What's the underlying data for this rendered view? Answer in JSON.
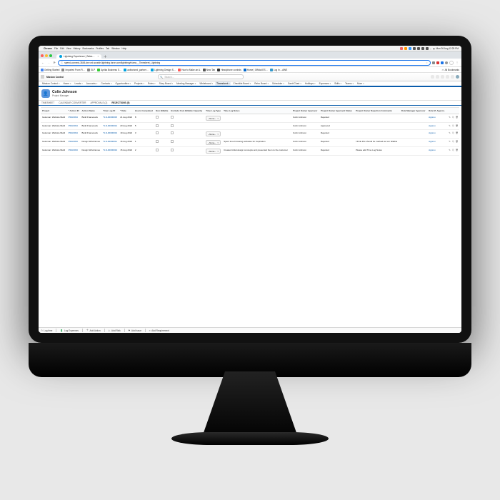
{
  "mac_menu": {
    "app": "Chrome",
    "items": [
      "File",
      "Edit",
      "View",
      "History",
      "Bookmarks",
      "Profiles",
      "Tab",
      "Window",
      "Help"
    ],
    "clock": "Mon 26 Aug  12:25 PM"
  },
  "chrome": {
    "tab_title": "Lightning Experience | Sales…",
    "url": "speed-connect-3845-dev-ed.scratch.lightning.force.com/lightning/n/amc__Timesheet_Lightning",
    "bookmarks": [
      "Getting Started",
      "Imported From Fi…",
      "SLP",
      "Aprika Business S…",
      "authorized_partner…",
      "Lightning Design S…",
      "How to Make an A.",
      "New Tab",
      "Headphone controls",
      "Home | Official ES…",
      "Log In – AWE"
    ],
    "all_bookmarks": "All Bookmarks"
  },
  "sf": {
    "app": "Mission Control",
    "search_placeholder": "Search…",
    "nav": [
      "Mission Control",
      "Home",
      "Leads",
      "Accounts",
      "Contacts",
      "Opportunities",
      "Projects",
      "Roles",
      "Story Board",
      "Meeting Manager",
      "Whiteboard",
      "Timesheet",
      "Checklist Board",
      "Retro Board",
      "Scheduler",
      "Gantt Chart",
      "Holidays",
      "Expenses",
      "Skills",
      "Teams",
      "More"
    ],
    "nav_active": "Timesheet"
  },
  "header": {
    "name": "Colin Johnson",
    "role": "Project Manager"
  },
  "subtabs": {
    "items": [
      "TIMESHEET",
      "CALENDAR CONVERTER",
      "APPROVALS (2)",
      "REJECTIONS (5)"
    ],
    "active": "REJECTIONS (5)"
  },
  "columns": [
    "Project",
    "* Action ID",
    "Action Name",
    "Time Log ID",
    "* Date",
    "Hours Completed",
    "Non Billable",
    "Exclude from Billable Capacity",
    "Time Log Type",
    "Time Log Notes",
    "Project Owner Approver",
    "Project Owner Approval Status",
    "Project Owner Rejection Comments",
    "Role Manager Approver",
    "Role M. Approv."
  ],
  "rows": [
    {
      "project": "Goleman: Website Build",
      "action_id": "PMA0034",
      "action": "Build Framework",
      "tlid": "TLN-00000015",
      "date": "21 Aug 2024",
      "hours": "8",
      "nb": false,
      "ex": false,
      "type": "--None--",
      "notes": "",
      "po_app": "Colin Johnson",
      "po_stat": "Rejected",
      "po_rej": "",
      "rm_app": "",
      "rm_appr": "Approv."
    },
    {
      "project": "Goleman: Website Build",
      "action_id": "PMA0034",
      "action": "Build Framework",
      "tlid": "TLN-00000014",
      "date": "20 Aug 2024",
      "hours": "5",
      "nb": false,
      "ex": false,
      "type": "",
      "notes": "",
      "po_app": "Colin Johnson",
      "po_stat": "Approved",
      "po_rej": "",
      "rm_app": "",
      "rm_appr": "Approv."
    },
    {
      "project": "Goleman: Website Build",
      "action_id": "PMA0034",
      "action": "Build Framework",
      "tlid": "TLN-00000013",
      "date": "19 Aug 2024",
      "hours": "3",
      "nb": false,
      "ex": false,
      "type": "--None--",
      "notes": "",
      "po_app": "Colin Johnson",
      "po_stat": "Rejected",
      "po_rej": "",
      "rm_app": "",
      "rm_appr": "Approv."
    },
    {
      "project": "Goleman: Website Build",
      "action_id": "PMA0033",
      "action": "Design Wireframes",
      "tlid": "TLN-00000011",
      "date": "16 Aug 2024",
      "hours": "1",
      "nb": false,
      "ex": false,
      "type": "--None--",
      "notes": "Spent time browsing websites for inspiration",
      "po_app": "Colin Johnson",
      "po_stat": "Rejected",
      "po_rej": "I think this should be marked as non billable",
      "rm_app": "",
      "rm_appr": "Approv."
    },
    {
      "project": "Goleman: Website Build",
      "action_id": "PMA0033",
      "action": "Design Wireframes",
      "tlid": "TLN-00000010",
      "date": "15 Aug 2024",
      "hours": "2",
      "nb": false,
      "ex": false,
      "type": "--None--",
      "notes": "Created initial design concepts and presented them to the customer",
      "po_app": "Colin Johnson",
      "po_stat": "Rejected",
      "po_rej": "Please add Time Log Notes",
      "rm_app": "",
      "rm_appr": "Approv."
    }
  ],
  "utility": [
    "Log time",
    "Log Expenses",
    "Add Action",
    "Add Risk",
    "Add Issue",
    "Add Requirement"
  ]
}
